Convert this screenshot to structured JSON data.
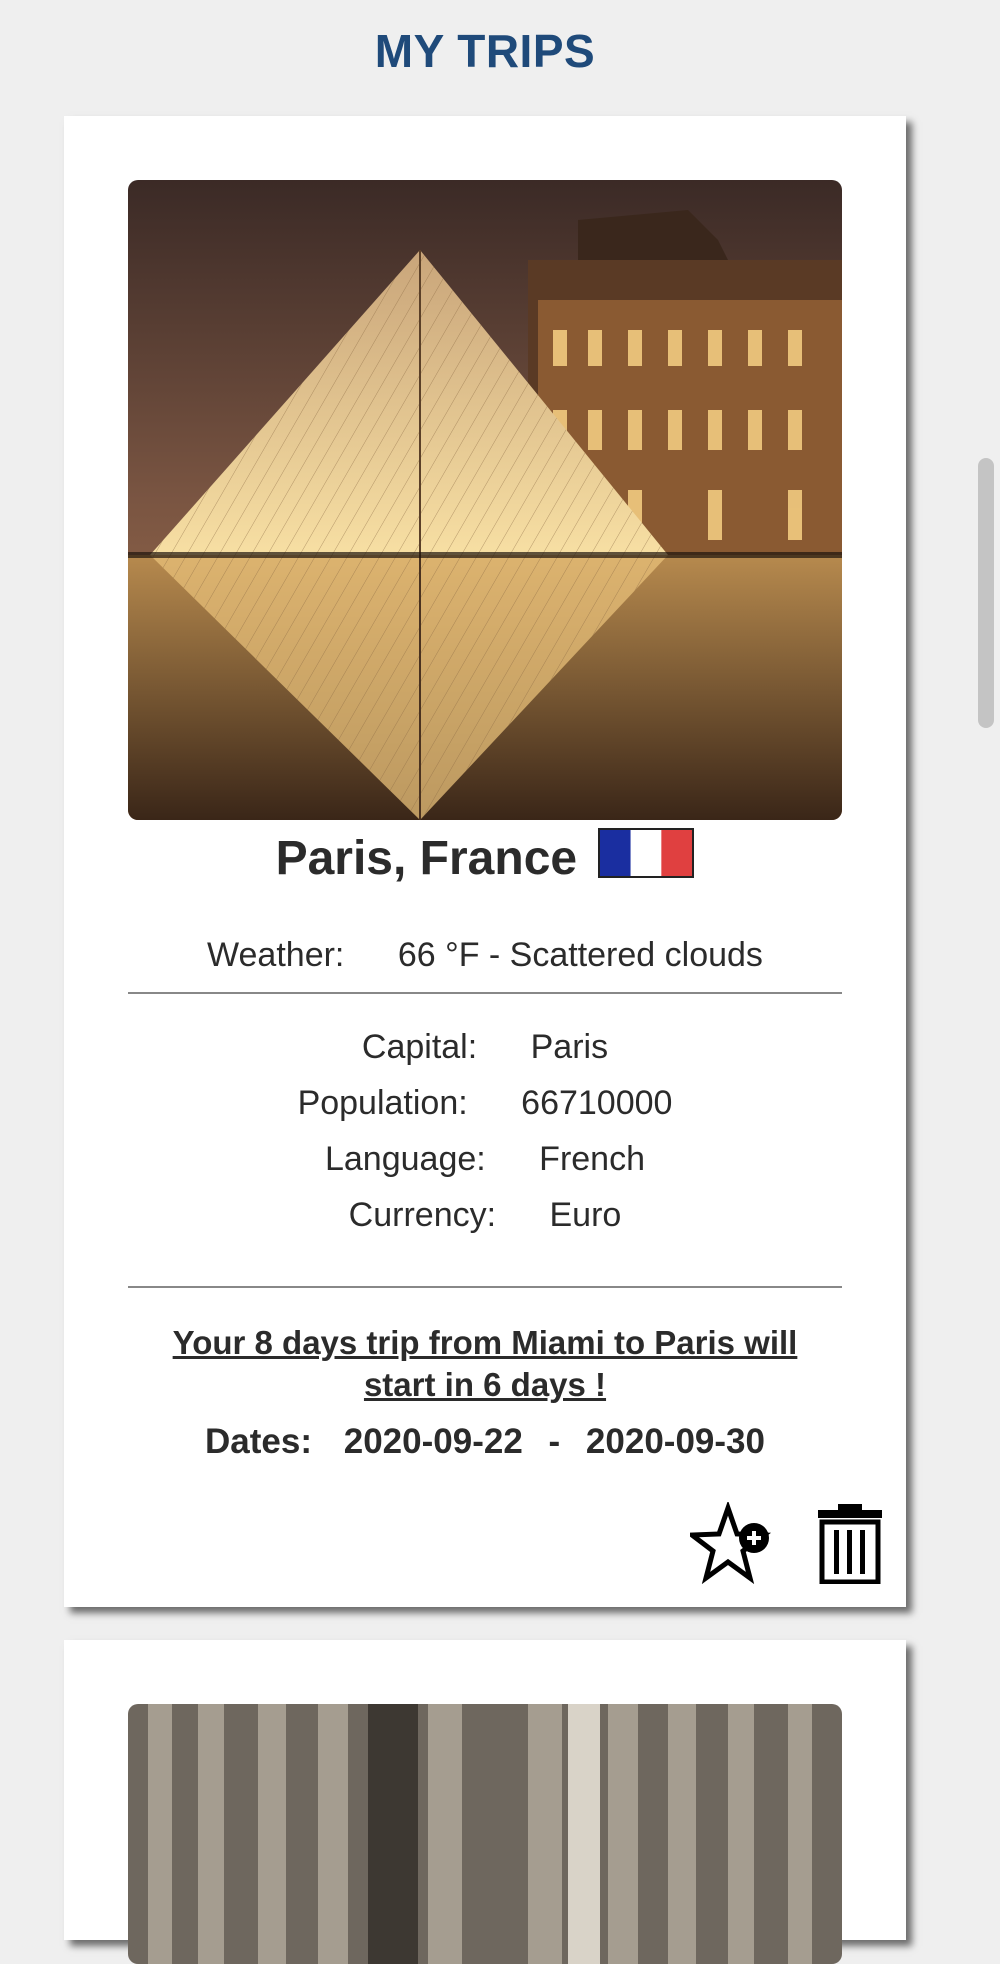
{
  "page": {
    "title": "MY TRIPS"
  },
  "trips": [
    {
      "destination": "Paris, France",
      "flag_colors": [
        "#1a2ea0",
        "#ffffff",
        "#e04040"
      ],
      "weather": {
        "label": "Weather:",
        "value": "66 °F - Scattered clouds"
      },
      "details": [
        {
          "label": "Capital:",
          "value": "Paris"
        },
        {
          "label": "Population:",
          "value": "66710000"
        },
        {
          "label": "Language:",
          "value": "French"
        },
        {
          "label": "Currency:",
          "value": "Euro"
        }
      ],
      "message": "Your 8 days trip from Miami to Paris will start in 6 days !",
      "dates": {
        "label": "Dates:",
        "start": "2020-09-22",
        "separator": "-",
        "end": "2020-09-30"
      },
      "actions": {
        "favorite_icon": "star-plus-icon",
        "delete_icon": "trash-icon"
      }
    }
  ]
}
